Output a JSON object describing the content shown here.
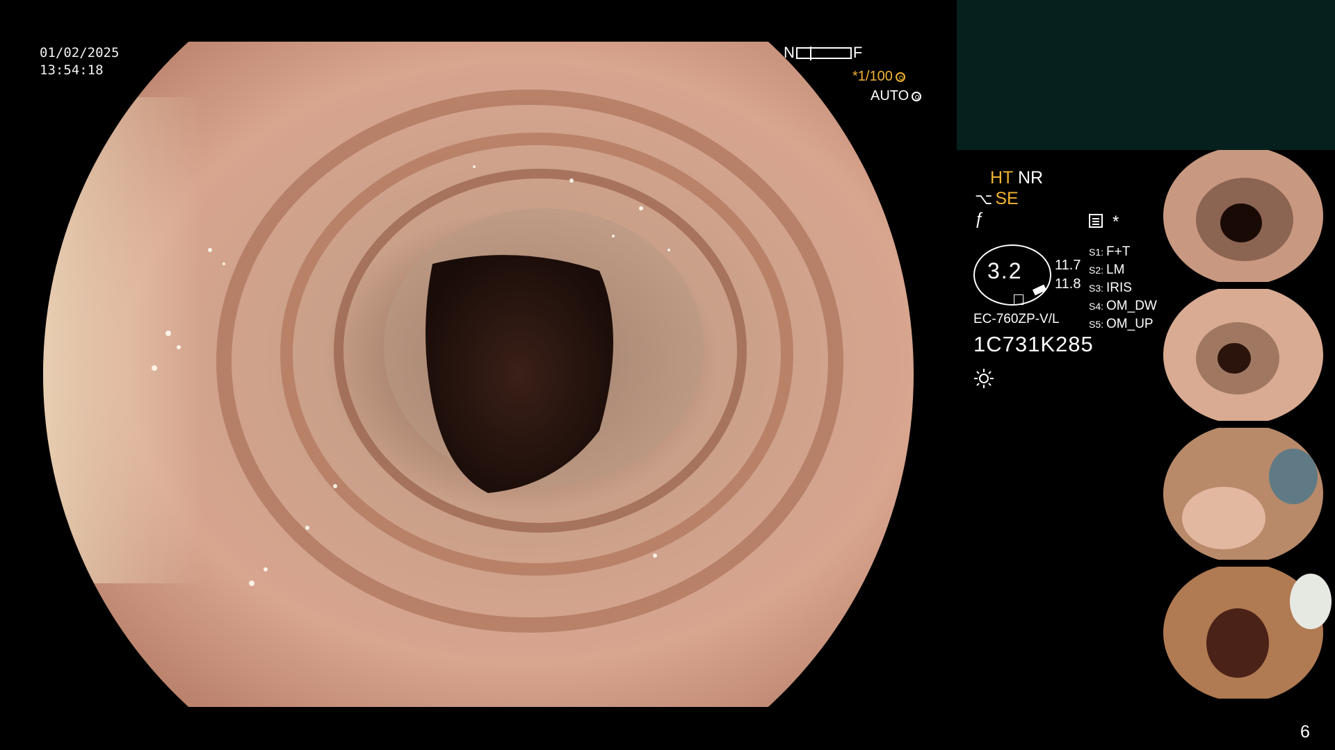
{
  "overlay": {
    "date": "01/02/2025",
    "time": "13:54:18",
    "near_label": "N",
    "far_label": "F",
    "shutter": "*1/100",
    "iris_mode": "AUTO"
  },
  "panel": {
    "ht": "HT",
    "nr": "NR",
    "se": "SE",
    "scope_value": "3.2",
    "value_top": "11.7",
    "value_bottom": "11.8",
    "switches": [
      {
        "key": "S1:",
        "value": "F+T"
      },
      {
        "key": "S2:",
        "value": "LM"
      },
      {
        "key": "S3:",
        "value": "IRIS"
      },
      {
        "key": "S4:",
        "value": "OM_DW"
      },
      {
        "key": "S5:",
        "value": "OM_UP"
      }
    ],
    "scope_model": "EC-760ZP-V/L",
    "serial": "1C731K285",
    "star": "*"
  },
  "thumbnails": [
    {
      "name": "capture-1"
    },
    {
      "name": "capture-2"
    },
    {
      "name": "capture-3"
    },
    {
      "name": "capture-4"
    }
  ],
  "page_number": "6",
  "colors": {
    "accent_orange": "#f2b233",
    "top_panel_bg": "#06201e",
    "mucosa": "#c98f76"
  }
}
